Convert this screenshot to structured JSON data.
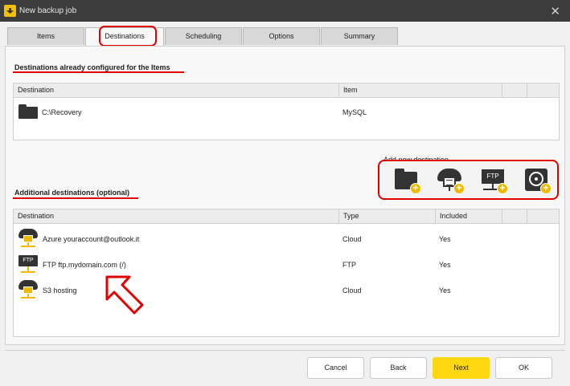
{
  "window": {
    "title": "New backup job",
    "close_glyph": "✕"
  },
  "tabs": [
    {
      "label": "Items"
    },
    {
      "label": "Destinations"
    },
    {
      "label": "Scheduling"
    },
    {
      "label": "Options"
    },
    {
      "label": "Summary"
    }
  ],
  "configured": {
    "heading": "Destinations already configured for the Items",
    "columns": [
      "Destination",
      "Item"
    ],
    "rows": [
      {
        "destination": "C:\\Recovery",
        "item": "MySQL",
        "icon": "folder-icon"
      }
    ]
  },
  "add_new": {
    "label": "Add new destination",
    "buttons": [
      {
        "name": "add-folder-destination",
        "icon": "folder-icon"
      },
      {
        "name": "add-cloud-destination",
        "icon": "cloud-server-icon"
      },
      {
        "name": "add-ftp-destination",
        "icon": "ftp-icon",
        "text": "FTP"
      },
      {
        "name": "add-disk-destination",
        "icon": "hard-disk-icon"
      }
    ]
  },
  "additional": {
    "heading": "Additional destinations (optional)",
    "columns": [
      "Destination",
      "Type",
      "Included"
    ],
    "rows": [
      {
        "destination": "Azure youraccount@outlook.it",
        "type": "Cloud",
        "included": "Yes",
        "icon": "cloud-icon"
      },
      {
        "destination": "FTP ftp.mydomain.com (/)",
        "type": "FTP",
        "included": "Yes",
        "icon": "ftp-icon",
        "icon_text": "FTP"
      },
      {
        "destination": "S3 hosting",
        "type": "Cloud",
        "included": "Yes",
        "icon": "cloud-icon"
      }
    ]
  },
  "footer": {
    "cancel": "Cancel",
    "back": "Back",
    "next": "Next",
    "ok": "OK"
  },
  "colors": {
    "accent": "#fdd812",
    "highlight": "#e00000",
    "titlebar": "#3c3c3c"
  }
}
